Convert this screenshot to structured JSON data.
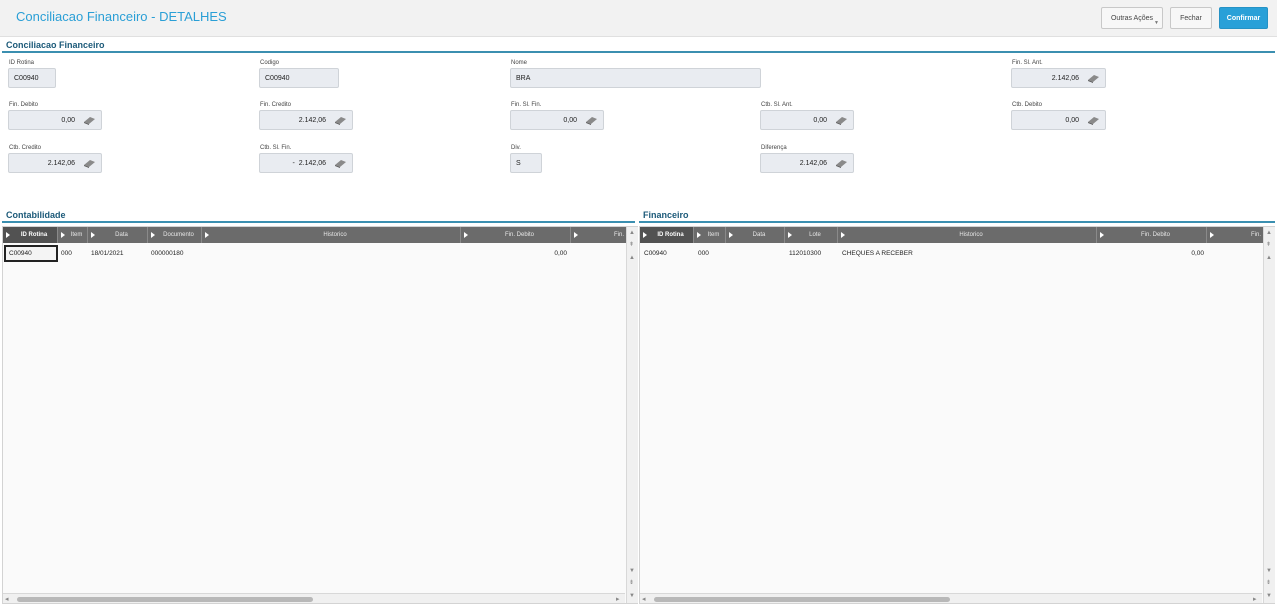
{
  "header": {
    "title": "Conciliacao Financeiro - DETALHES",
    "more_actions": "Outras Ações",
    "close": "Fechar",
    "confirm": "Confirmar"
  },
  "form": {
    "section_title": "Conciliacao Financeiro",
    "id_rotina": {
      "label": "ID Rotina",
      "value": "C00940"
    },
    "codigo": {
      "label": "Codigo",
      "value": "C00940"
    },
    "nome": {
      "label": "Nome",
      "value": "BRA"
    },
    "fin_sl_ant": {
      "label": "Fin. Sl. Ant.",
      "value": "2.142,06"
    },
    "fin_debito": {
      "label": "Fin. Debito",
      "value": "0,00"
    },
    "fin_credito": {
      "label": "Fin. Credito",
      "value": "2.142,06"
    },
    "fin_sl_fin": {
      "label": "Fin. Sl. Fin.",
      "value": "0,00"
    },
    "ctb_sl_ant": {
      "label": "Ctb. Sl. Ant.",
      "value": "0,00"
    },
    "ctb_debito": {
      "label": "Ctb. Debito",
      "value": "0,00"
    },
    "ctb_credito": {
      "label": "Ctb. Credito",
      "value": "2.142,06"
    },
    "ctb_sl_fin": {
      "label": "Ctb. Sl. Fin.",
      "value": "-  2.142,06"
    },
    "div": {
      "label": "Div.",
      "value": "S"
    },
    "diferenca": {
      "label": "Diferença",
      "value": "2.142,06"
    }
  },
  "contabilidade": {
    "title": "Contabilidade",
    "columns": [
      "ID Rotina",
      "Item",
      "Data",
      "Documento",
      "Historico",
      "Fin. Debito",
      "Fin."
    ],
    "rows": [
      {
        "id_rotina": "C00940",
        "item": "000",
        "data": "18/01/2021",
        "documento": "000000180",
        "historico": "",
        "fin_debito": "0,00",
        "fin": ""
      }
    ]
  },
  "financeiro": {
    "title": "Financeiro",
    "columns": [
      "ID Rotina",
      "Item",
      "Data",
      "Lote",
      "Historico",
      "Fin. Debito",
      "Fin."
    ],
    "rows": [
      {
        "id_rotina": "C00940",
        "item": "000",
        "data": "",
        "lote": "112010300",
        "historico": "CHEQUES A RECEBER",
        "fin_debito": "0,00",
        "fin": ""
      }
    ]
  },
  "icons": {
    "calculator": "calculator-icon",
    "sort": "sort-arrow-icon"
  }
}
